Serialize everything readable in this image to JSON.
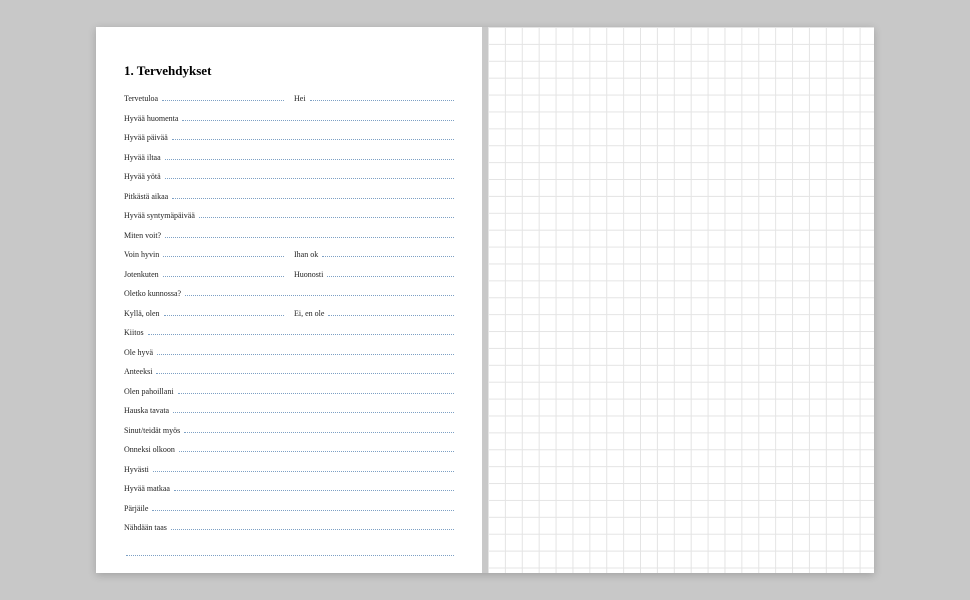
{
  "title": "1. Tervehdykset",
  "rows": [
    {
      "type": "pair",
      "a": "Tervetuloa",
      "b": "Hei"
    },
    {
      "type": "single",
      "a": "Hyvää huomenta"
    },
    {
      "type": "single",
      "a": "Hyvää päivää"
    },
    {
      "type": "single",
      "a": "Hyvää iltaa"
    },
    {
      "type": "single",
      "a": "Hyvää yötä"
    },
    {
      "type": "single",
      "a": "Pitkästä aikaa"
    },
    {
      "type": "single",
      "a": "Hyvää syntymäpäivää"
    },
    {
      "type": "single",
      "a": "Miten voit?"
    },
    {
      "type": "pair",
      "a": "Voin hyvin",
      "b": "Ihan ok"
    },
    {
      "type": "pair",
      "a": "Jotenkuten",
      "b": "Huonosti"
    },
    {
      "type": "single",
      "a": "Oletko kunnossa?"
    },
    {
      "type": "pair",
      "a": "Kyllä, olen",
      "b": "Ei, en ole"
    },
    {
      "type": "single",
      "a": "Kiitos"
    },
    {
      "type": "single",
      "a": "Ole hyvä"
    },
    {
      "type": "single",
      "a": "Anteeksi"
    },
    {
      "type": "single",
      "a": "Olen pahoillani"
    },
    {
      "type": "single",
      "a": "Hauska tavata"
    },
    {
      "type": "single",
      "a": "Sinut/teidät myös"
    },
    {
      "type": "single",
      "a": "Onneksi olkoon"
    },
    {
      "type": "single",
      "a": "Hyvästi"
    },
    {
      "type": "single",
      "a": "Hyvää matkaa"
    },
    {
      "type": "single",
      "a": "Pärjäile"
    },
    {
      "type": "single",
      "a": "Nähdään taas"
    },
    {
      "type": "blank"
    }
  ]
}
